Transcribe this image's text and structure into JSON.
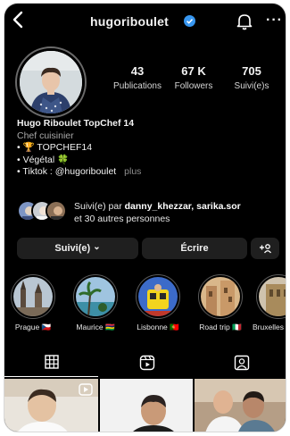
{
  "header": {
    "username": "hugoriboulet",
    "more_label": "···"
  },
  "stats": [
    {
      "value": "43",
      "label": "Publications"
    },
    {
      "value": "67 K",
      "label": "Followers"
    },
    {
      "value": "705",
      "label": "Suivi(e)s"
    }
  ],
  "bio": {
    "name": "Hugo Riboulet TopChef 14",
    "category": "Chef cuisinier",
    "line1": "• 🏆 TOPCHEF14",
    "line2": "• Végétal 🍀",
    "line3": "• Tiktok : @hugoriboulet",
    "more": "plus"
  },
  "followed_by": {
    "prefix": "Suivi(e) par ",
    "accounts": "danny_khezzar, sarika.sor",
    "suffix": "et 30 autres personnes"
  },
  "actions": {
    "follow": "Suivi(e)",
    "follow_chevron": "⌄",
    "message": "Écrire",
    "add_user": "+₂"
  },
  "highlights": [
    {
      "label": "Prague 🇨🇿"
    },
    {
      "label": "Maurice 🇲🇺"
    },
    {
      "label": "Lisbonne 🇵🇹"
    },
    {
      "label": "Road trip 🇮🇹"
    },
    {
      "label": "Bruxelles"
    }
  ],
  "colors": {
    "verified": "#3897f0",
    "background": "#000000",
    "button": "#1f1f1f"
  }
}
